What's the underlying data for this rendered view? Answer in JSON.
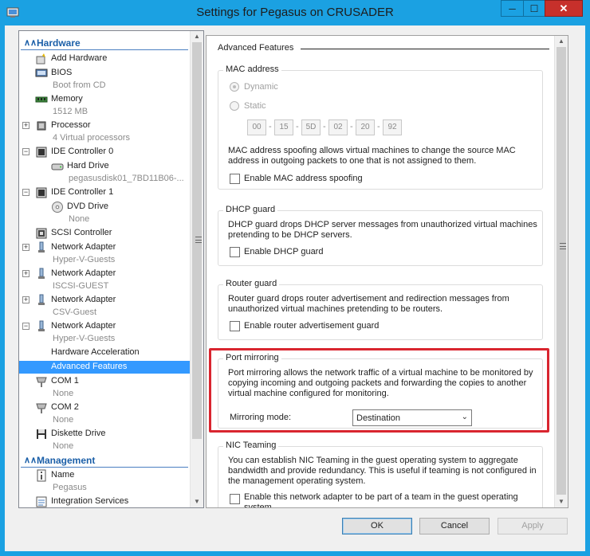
{
  "window": {
    "title": "Settings for Pegasus on CRUSADER"
  },
  "tree": {
    "hardware_header": "Hardware",
    "management_header": "Management",
    "items": [
      {
        "label": "Add Hardware",
        "sub": ""
      },
      {
        "label": "BIOS",
        "sub": "Boot from CD"
      },
      {
        "label": "Memory",
        "sub": "1512 MB"
      },
      {
        "label": "Processor",
        "sub": "4 Virtual processors"
      },
      {
        "label": "IDE Controller 0",
        "sub": ""
      },
      {
        "label": "Hard Drive",
        "sub": "pegasusdisk01_7BD11B06-..."
      },
      {
        "label": "IDE Controller 1",
        "sub": ""
      },
      {
        "label": "DVD Drive",
        "sub": "None"
      },
      {
        "label": "SCSI Controller",
        "sub": ""
      },
      {
        "label": "Network Adapter",
        "sub": "Hyper-V-Guests"
      },
      {
        "label": "Network Adapter",
        "sub": "ISCSI-GUEST"
      },
      {
        "label": "Network Adapter",
        "sub": "CSV-Guest"
      },
      {
        "label": "Network Adapter",
        "sub": "Hyper-V-Guests"
      },
      {
        "label": "Hardware Acceleration",
        "sub": ""
      },
      {
        "label": "Advanced Features",
        "sub": ""
      },
      {
        "label": "COM 1",
        "sub": "None"
      },
      {
        "label": "COM 2",
        "sub": "None"
      },
      {
        "label": "Diskette Drive",
        "sub": "None"
      },
      {
        "label": "Name",
        "sub": "Pegasus"
      },
      {
        "label": "Integration Services",
        "sub": ""
      }
    ]
  },
  "panel": {
    "heading": "Advanced Features",
    "mac": {
      "title": "MAC address",
      "dynamic_label": "Dynamic",
      "static_label": "Static",
      "octets": [
        "00",
        "15",
        "5D",
        "02",
        "20",
        "92"
      ],
      "spoof_desc": "MAC address spoofing allows virtual machines to change the source MAC address in outgoing packets to one that is not assigned to them.",
      "spoof_checkbox": "Enable MAC address spoofing"
    },
    "dhcp": {
      "title": "DHCP guard",
      "desc": "DHCP guard drops DHCP server messages from unauthorized virtual machines pretending to be DHCP servers.",
      "checkbox": "Enable DHCP guard"
    },
    "router": {
      "title": "Router guard",
      "desc": "Router guard drops router advertisement and redirection messages from unauthorized virtual machines pretending to be routers.",
      "checkbox": "Enable router advertisement guard"
    },
    "port_mirroring": {
      "title": "Port mirroring",
      "desc": "Port mirroring allows the network traffic of a virtual machine to be monitored by copying incoming and outgoing packets and forwarding the copies to another virtual machine configured for monitoring.",
      "mode_label": "Mirroring mode:",
      "mode_value": "Destination"
    },
    "nic_teaming": {
      "title": "NIC Teaming",
      "desc": "You can establish NIC Teaming in the guest operating system to aggregate bandwidth and provide redundancy. This is useful if teaming is not configured in the management operating system.",
      "checkbox": "Enable this network adapter to be part of a team in the guest operating system"
    }
  },
  "buttons": {
    "ok": "OK",
    "cancel": "Cancel",
    "apply": "Apply"
  },
  "colors": {
    "titlebar": "#1ba1e2",
    "selection": "#3399ff",
    "highlight_border": "#d9252f",
    "section_header": "#1b5fa8"
  }
}
